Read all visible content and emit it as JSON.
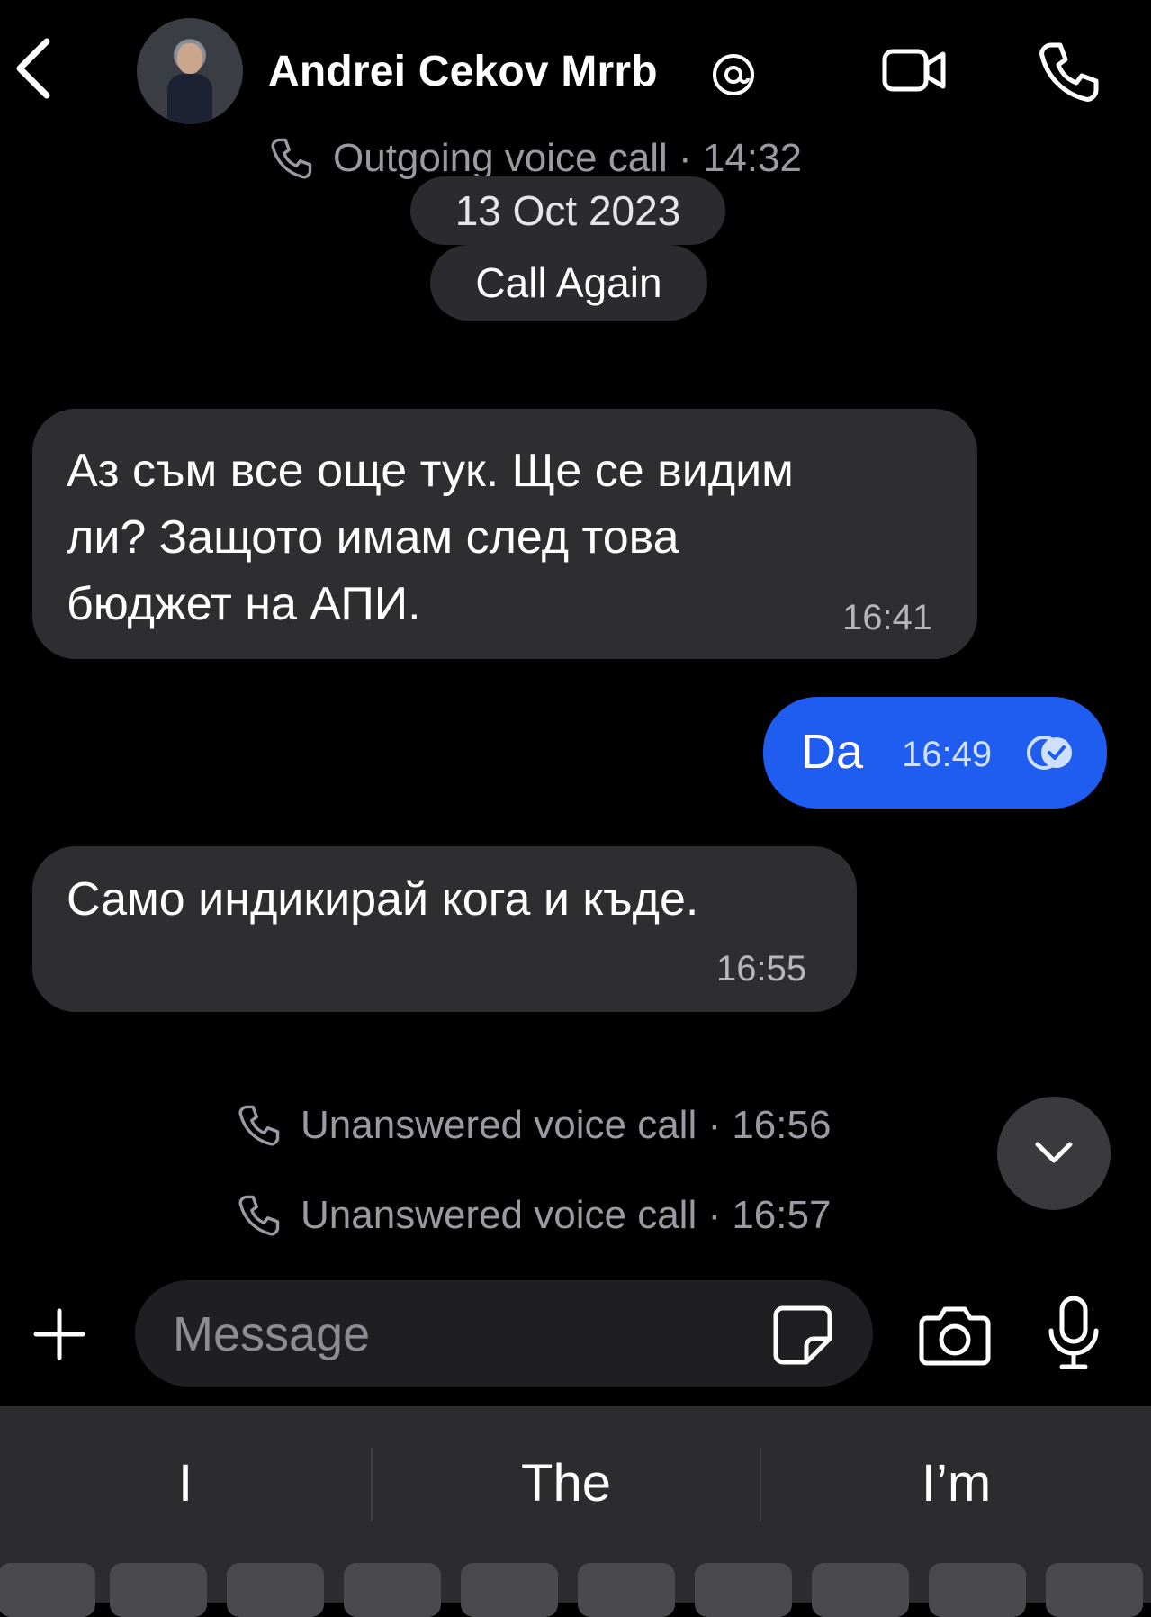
{
  "header": {
    "contact_name": "Andrei Cekov Mrrb",
    "icons": [
      "back-chevron-icon",
      "avatar",
      "verified-at-icon",
      "video-camera-icon",
      "phone-icon"
    ]
  },
  "system": {
    "outgoing_call": "Outgoing voice call · 14:32",
    "date_pill": "13 Oct 2023",
    "call_again": "Call Again",
    "unanswered_1": "Unanswered voice call · 16:56",
    "unanswered_2": "Unanswered voice call · 16:57"
  },
  "messages": [
    {
      "direction": "incoming",
      "lines": [
        "Аз съм все още тук. Ще се видим",
        "ли? Защото имам след това",
        "бюджет на АПИ."
      ],
      "time": "16:41"
    },
    {
      "direction": "outgoing",
      "text": "Da",
      "time": "16:49",
      "status_icon": "read-check-icon"
    },
    {
      "direction": "incoming",
      "lines": [
        "Само индикирай кога и къде."
      ],
      "time": "16:55"
    }
  ],
  "composer": {
    "placeholder": "Message",
    "icons": [
      "plus-icon",
      "sticker-icon",
      "camera-icon",
      "microphone-icon"
    ]
  },
  "keyboard": {
    "suggestions": [
      "I",
      "The",
      "I’m"
    ]
  },
  "colors": {
    "background": "#000000",
    "incoming_bubble": "#2e2e31",
    "outgoing_bubble": "#1f5cf0",
    "muted_text": "#9a9aa0"
  }
}
